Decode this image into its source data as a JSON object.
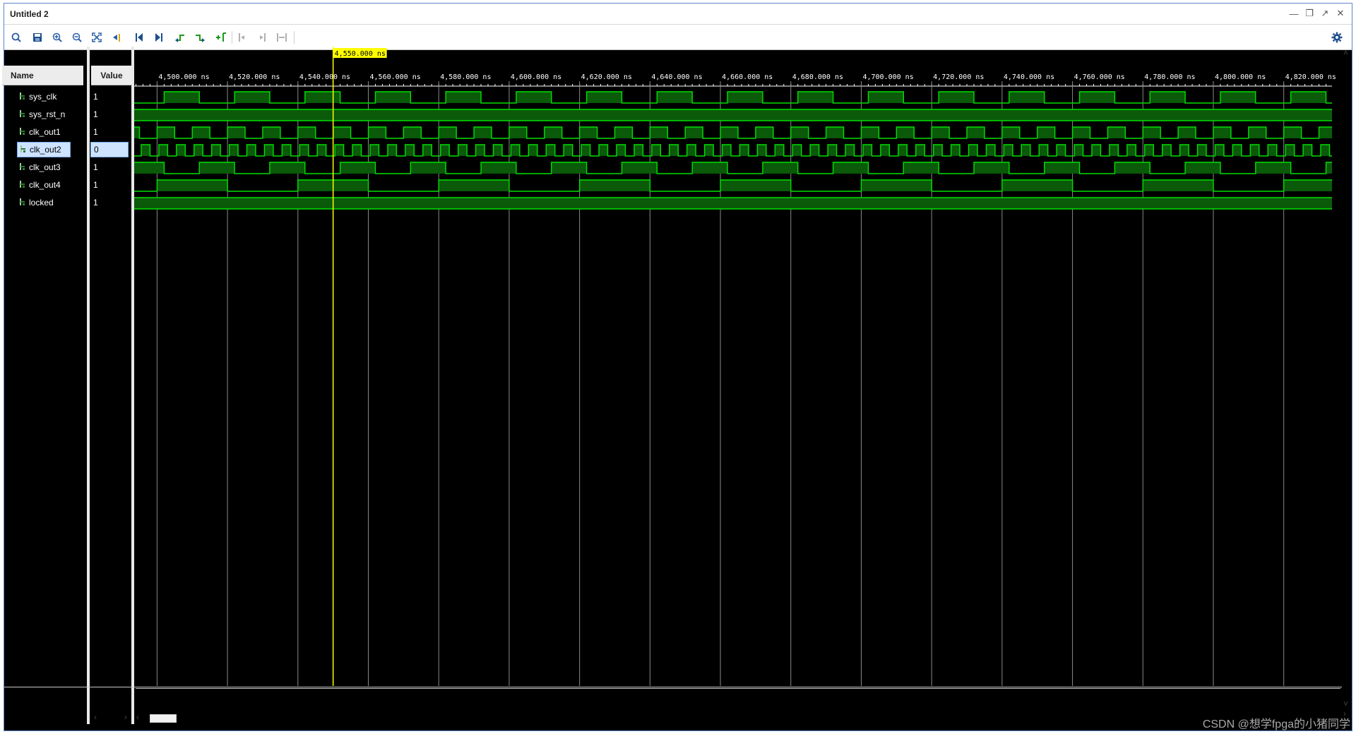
{
  "window": {
    "title": "Untitled 2"
  },
  "window_controls": [
    "minimize-icon",
    "restore-icon",
    "maximize-icon",
    "close-icon"
  ],
  "toolbar": {
    "buttons": [
      "search-icon",
      "save-icon",
      "zoom-in-icon",
      "zoom-out-icon",
      "zoom-fit-icon",
      "go-to-cursor-icon",
      "go-to-start-icon",
      "go-to-end-icon",
      "previous-transition-icon",
      "next-transition-icon",
      "add-marker-icon",
      "previous-marker-icon",
      "next-marker-icon",
      "swap-cursors-icon"
    ]
  },
  "panel": {
    "name_header": "Name",
    "value_header": "Value"
  },
  "signals": [
    {
      "name": "sys_clk",
      "value": "1",
      "selected": false
    },
    {
      "name": "sys_rst_n",
      "value": "1",
      "selected": false
    },
    {
      "name": "clk_out1",
      "value": "1",
      "selected": false
    },
    {
      "name": "clk_out2",
      "value": "0",
      "selected": true
    },
    {
      "name": "clk_out3",
      "value": "1",
      "selected": false
    },
    {
      "name": "clk_out4",
      "value": "1",
      "selected": false
    },
    {
      "name": "locked",
      "value": "1",
      "selected": false
    }
  ],
  "timeline": {
    "cursor_label": "4,550.000 ns",
    "cursor_time_ns": 4550,
    "start_ns": 4493.5,
    "end_ns": 4833.7,
    "tick_labels": [
      "4,500.000 ns",
      "4,520.000 ns",
      "4,540.000 ns",
      "4,560.000 ns",
      "4,580.000 ns",
      "4,600.000 ns",
      "4,620.000 ns",
      "4,640.000 ns",
      "4,660.000 ns",
      "4,680.000 ns",
      "4,700.000 ns",
      "4,720.000 ns",
      "4,740.000 ns",
      "4,760.000 ns",
      "4,780.000 ns",
      "4,800.000 ns",
      "4,820.000 ns"
    ],
    "tick_values_ns": [
      4500,
      4520,
      4540,
      4560,
      4580,
      4600,
      4620,
      4640,
      4660,
      4680,
      4700,
      4720,
      4740,
      4760,
      4780,
      4800,
      4820
    ]
  },
  "colors": {
    "wave_line": "#00e000",
    "wave_fill": "#0a5a0a",
    "cursor": "#ffff00",
    "grid": "#8a8a8a",
    "background": "#000000"
  },
  "watermark": "CSDN @想学fpga的小猪同学"
}
